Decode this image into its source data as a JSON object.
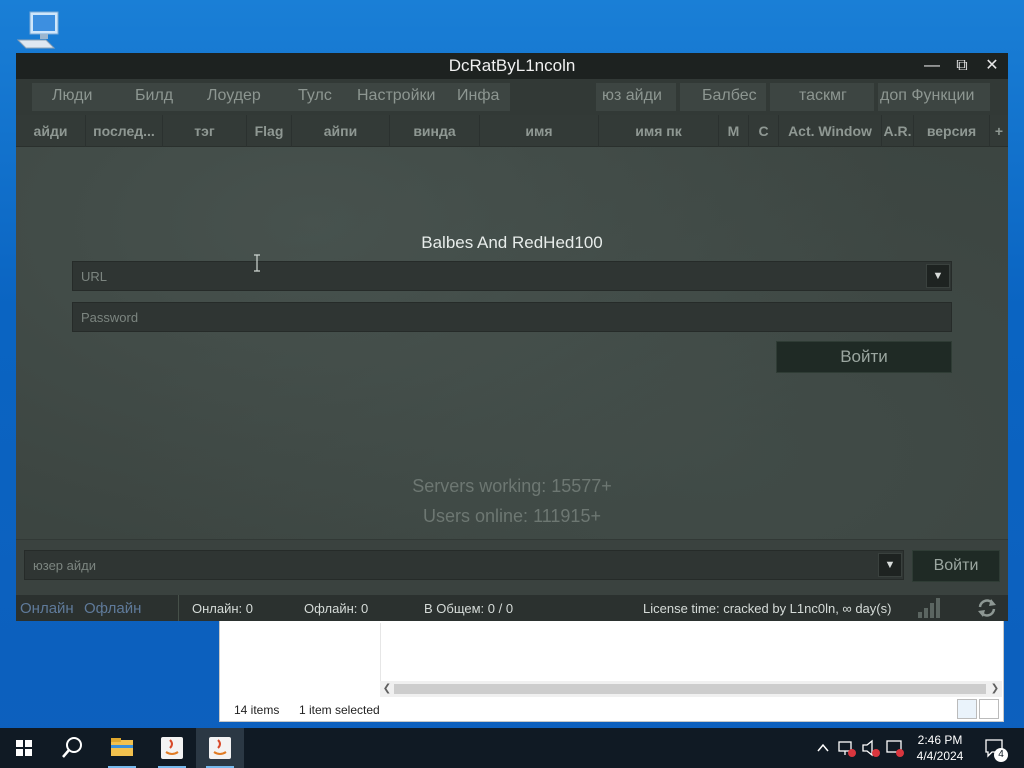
{
  "app": {
    "title": "DcRatByL1ncoln",
    "window_controls": {
      "minimize": "—",
      "maximize": "⧉",
      "close": "✕"
    },
    "menu": [
      "Люди",
      "Билд",
      "Лоудер",
      "Тулс",
      "Настройки",
      "Инфа",
      "юз айди",
      "Балбес",
      "таскмг",
      "доп Функции"
    ],
    "columns": [
      "айди",
      "послед...",
      "тэг",
      "Flag",
      "айпи",
      "винда",
      "имя",
      "имя пк",
      "M",
      "C",
      "Act. Window",
      "A.R.",
      "версия",
      "+"
    ],
    "login": {
      "heading": "Balbes And RedHed100",
      "url_placeholder": "URL",
      "password_placeholder": "Password",
      "login_button": "Войти"
    },
    "stats": {
      "servers": "Servers working: 15577+",
      "users": "Users online: 111915+"
    },
    "bottom": {
      "user_id_placeholder": "юзер айди",
      "login_button": "Войти"
    },
    "statusbar": {
      "online_tab": "Онлайн",
      "offline_tab": "Офлайн",
      "online_count": "Онлайн: 0",
      "offline_count": "Офлайн: 0",
      "total": "В Общем: 0 / 0",
      "license": "License time: cracked by L1nc0ln, ∞ day(s)"
    }
  },
  "explorer": {
    "items": "14 items",
    "selected": "1 item selected"
  },
  "taskbar": {
    "time": "2:46 PM",
    "date": "4/4/2024",
    "notifications": "4"
  },
  "colors": {
    "desktop": "#0a64c2",
    "app_bg": "#3c4541",
    "titlebar": "#1d2220",
    "taskbar": "#101a24"
  }
}
